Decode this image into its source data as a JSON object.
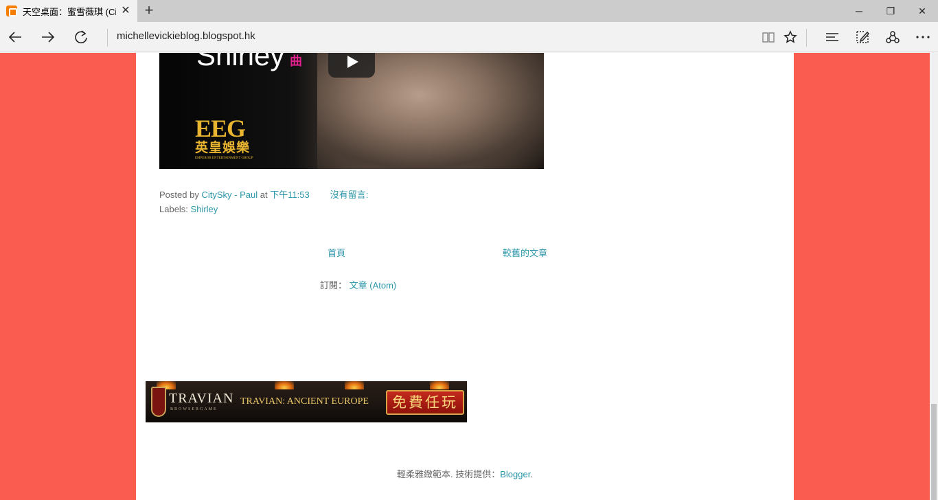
{
  "browser": {
    "tab_title": "天空桌面：蜜雪薇琪 (Ci",
    "tab_close": "✕",
    "new_tab": "+",
    "address": "michellevickieblog.blogspot.hk",
    "window_controls": {
      "minimize": "─",
      "maximize": "❐",
      "close": "✕"
    },
    "icons": [
      "back-arrow-icon",
      "forward-arrow-icon",
      "refresh-icon",
      "reading-view-icon",
      "favorite-star-icon",
      "hub-icon",
      "web-note-icon",
      "share-icon",
      "more-icon"
    ]
  },
  "video": {
    "title": "Shirley",
    "subtitle": "曲",
    "logo_mark": "EEG",
    "logo_cn": "英皇娛樂",
    "logo_en": "EMPEROR ENTERTAINMENT GROUP"
  },
  "post_footer": {
    "posted_by": "Posted by",
    "author": "CitySky - Paul",
    "at": "at",
    "time": "下午11:53",
    "comments": "沒有留言:",
    "labels_prefix": "Labels:",
    "label": "Shirley"
  },
  "pager": {
    "home": "首頁",
    "older": "較舊的文章"
  },
  "feed": {
    "prefix": "訂閱：",
    "link": "文章 (Atom)"
  },
  "ad": {
    "brand": "TRAVIAN",
    "brand_sub": "BROWSERGAME",
    "title": "TRAVIAN: ANCIENT EUROPE",
    "cta": "免費任玩"
  },
  "attribution": {
    "text": "輕柔雅緻範本. 技術提供：",
    "link": "Blogger",
    "suffix": "."
  },
  "colors": {
    "page_background": "#fa5c50",
    "link": "#2b96a8",
    "content_background": "#ffffff"
  }
}
